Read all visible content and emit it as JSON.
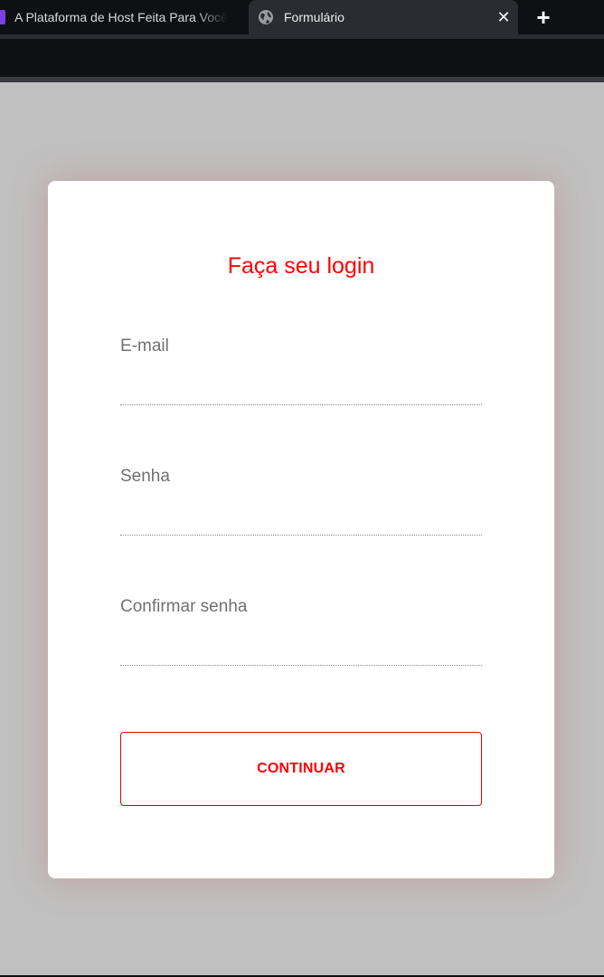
{
  "browser": {
    "tabs": [
      {
        "title": "A Plataforma de Host Feita Para Você",
        "active": false
      },
      {
        "title": "Formulário",
        "active": true
      }
    ],
    "close_glyph": "✕",
    "new_tab_glyph": "+",
    "favicon_color": "#7b3fe4"
  },
  "form": {
    "title": "Faça seu login",
    "fields": [
      {
        "label": "E-mail",
        "value": ""
      },
      {
        "label": "Senha",
        "value": ""
      },
      {
        "label": "Confirmar senha",
        "value": ""
      }
    ],
    "submit_label": "CONTINUAR"
  },
  "colors": {
    "accent": "#ff0000",
    "background": "#c0c0c0",
    "card": "#ffffff",
    "label": "#707070"
  }
}
